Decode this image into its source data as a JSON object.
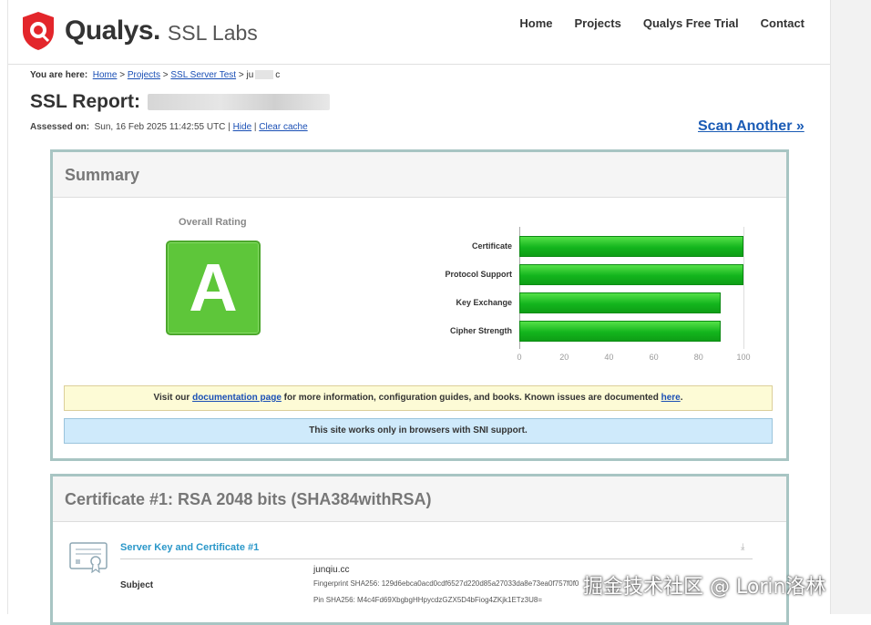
{
  "header": {
    "brand": "Qualys.",
    "product": "SSL Labs",
    "nav": [
      "Home",
      "Projects",
      "Qualys Free Trial",
      "Contact"
    ]
  },
  "breadcrumb": {
    "prefix": "You are here:",
    "items": [
      "Home",
      "Projects",
      "SSL Server Test"
    ],
    "separator": ">",
    "current_start": "ju",
    "current_end": "c"
  },
  "report": {
    "title": "SSL Report:",
    "assessed_label": "Assessed on:",
    "assessed_value": "Sun, 16 Feb 2025 11:42:55 UTC",
    "hide": "Hide",
    "clear_cache": "Clear cache",
    "scan_another": "Scan Another »"
  },
  "summary": {
    "heading": "Summary",
    "overall_label": "Overall Rating",
    "grade": "A",
    "grade_color": "#5ec63a",
    "notice_pre": "Visit our",
    "notice_link1": "documentation page",
    "notice_mid": "for more information, configuration guides, and books. Known issues are documented",
    "notice_link2": "here",
    "notice_end": ".",
    "sni_notice": "This site works only in browsers with SNI support."
  },
  "chart_data": {
    "type": "bar",
    "orientation": "horizontal",
    "categories": [
      "Certificate",
      "Protocol Support",
      "Key Exchange",
      "Cipher Strength"
    ],
    "values": [
      100,
      100,
      90,
      90
    ],
    "xlim": [
      0,
      100
    ],
    "xticks": [
      0,
      20,
      40,
      60,
      80,
      100
    ],
    "bar_color": "#13b51d",
    "grid": false
  },
  "certificate": {
    "heading": "Certificate #1: RSA 2048 bits (SHA384withRSA)",
    "section": "Server Key and Certificate #1",
    "subject_label": "Subject",
    "subject_value": "junqiu.cc",
    "fingerprint": "Fingerprint SHA256: 129d6ebca0acd0cdf6527d220d85a27033da8e73ea0f757f0f0",
    "pin": "Pin SHA256: M4c4Fd69XbgbgHHpycdzGZX5D4bFiog4ZKjk1ETz3U8="
  },
  "watermark": "掘金技术社区 @ Lorin洛林"
}
